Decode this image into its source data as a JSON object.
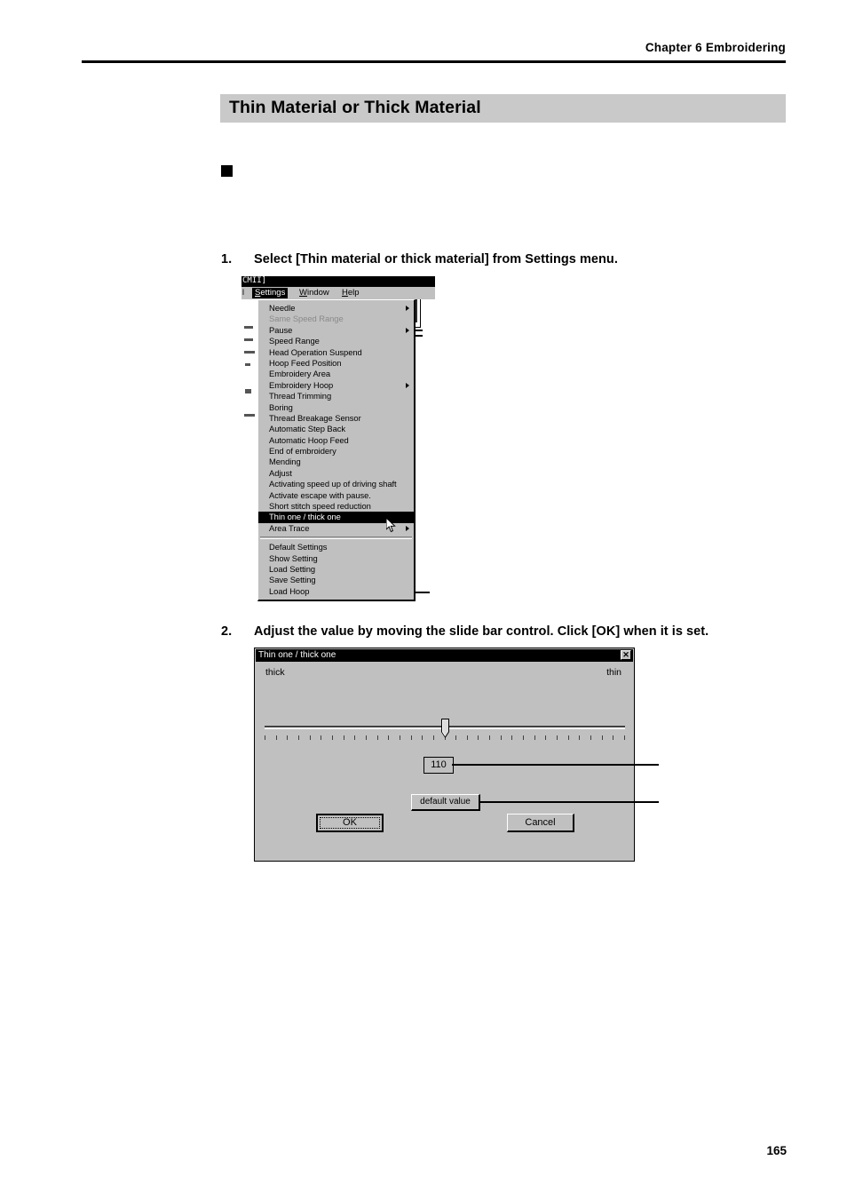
{
  "header": {
    "chapter_label": "Chapter 6  Embroidering"
  },
  "section": {
    "title": "Thin Material or Thick Material"
  },
  "steps": [
    {
      "number": "1.",
      "text": "Select [Thin material or thick material] from Settings menu."
    },
    {
      "number": "2.",
      "text": "Adjust the value by moving the slide bar control.  Click [OK] when it is set."
    }
  ],
  "footer": {
    "page_number": "165"
  },
  "menu_figure": {
    "window_title": "CMII]",
    "menubar_left_text": "l",
    "menubar": [
      {
        "label": "Settings",
        "underline": "S",
        "active": true
      },
      {
        "label": "Window",
        "underline": "W",
        "active": false
      },
      {
        "label": "Help",
        "underline": "H",
        "active": false
      }
    ],
    "dropdown_items": [
      {
        "label": "Needle",
        "underline": "",
        "submenu": true,
        "disabled": false,
        "selected": false
      },
      {
        "label": "Same Speed Range",
        "underline": "S",
        "submenu": false,
        "disabled": true,
        "selected": false
      },
      {
        "label": "Pause",
        "underline": "",
        "submenu": true,
        "disabled": false,
        "selected": false
      },
      {
        "label": "Speed Range",
        "underline": "R",
        "submenu": false,
        "disabled": false,
        "selected": false
      },
      {
        "label": "Head Operation Suspend",
        "underline": "u",
        "submenu": false,
        "disabled": false,
        "selected": false
      },
      {
        "label": "Hoop Feed Position",
        "underline": "F",
        "submenu": false,
        "disabled": false,
        "selected": false
      },
      {
        "label": "Embroidery Area",
        "underline": "A",
        "submenu": false,
        "disabled": false,
        "selected": false
      },
      {
        "label": "Embroidery Hoop",
        "underline": "E",
        "submenu": true,
        "disabled": false,
        "selected": false
      },
      {
        "label": "Thread Trimming",
        "underline": "T",
        "submenu": false,
        "disabled": false,
        "selected": false
      },
      {
        "label": "Boring",
        "underline": "B",
        "submenu": false,
        "disabled": false,
        "selected": false
      },
      {
        "label": "Thread Breakage Sensor",
        "underline": "k",
        "submenu": false,
        "disabled": false,
        "selected": false
      },
      {
        "label": "Automatic Step Back",
        "underline": "",
        "submenu": false,
        "disabled": false,
        "selected": false
      },
      {
        "label": "Automatic Hoop Feed",
        "underline": "o",
        "submenu": false,
        "disabled": false,
        "selected": false
      },
      {
        "label": "End of embroidery",
        "underline": "n",
        "submenu": false,
        "disabled": false,
        "selected": false
      },
      {
        "label": "Mending",
        "underline": "",
        "submenu": false,
        "disabled": false,
        "selected": false
      },
      {
        "label": "Adjust",
        "underline": "j",
        "submenu": false,
        "disabled": false,
        "selected": false
      },
      {
        "label": "Activating speed up of driving shaft",
        "underline": "p",
        "submenu": false,
        "disabled": false,
        "selected": false
      },
      {
        "label": "Activate escape with pause.",
        "underline": "c",
        "submenu": false,
        "disabled": false,
        "selected": false
      },
      {
        "label": "Short stitch speed reduction",
        "underline": "S",
        "submenu": false,
        "disabled": false,
        "selected": false
      },
      {
        "label": "Thin one / thick one",
        "underline": "",
        "submenu": false,
        "disabled": false,
        "selected": true
      },
      {
        "label": "Area Trace",
        "underline": "",
        "submenu": true,
        "disabled": false,
        "selected": false
      },
      {
        "separator": true
      },
      {
        "label": "Default Settings",
        "underline": "D",
        "submenu": false,
        "disabled": false,
        "selected": false
      },
      {
        "label": "Show Setting",
        "underline": "w",
        "submenu": false,
        "disabled": false,
        "selected": false
      },
      {
        "label": "Load Setting",
        "underline": "o",
        "submenu": false,
        "disabled": false,
        "selected": false
      },
      {
        "label": "Save Setting",
        "underline": "v",
        "submenu": false,
        "disabled": false,
        "selected": false
      },
      {
        "label": "Load Hoop",
        "underline": "H",
        "submenu": false,
        "disabled": false,
        "selected": false
      }
    ]
  },
  "dialog": {
    "title": "Thin one / thick one",
    "close_label": "✕",
    "label_left": "thick",
    "label_right": "thin",
    "value": "110",
    "slider": {
      "min_label": "thick",
      "max_label": "thin",
      "tick_count": 33,
      "thumb_percent": 50
    },
    "default_value_label": "default value",
    "ok_label": "OK",
    "cancel_label": "Cancel"
  },
  "colors": {
    "band_gray": "#c9c9c9",
    "window_face": "#c0c0c0",
    "titlebar": "#000000",
    "selection": "#000000"
  }
}
